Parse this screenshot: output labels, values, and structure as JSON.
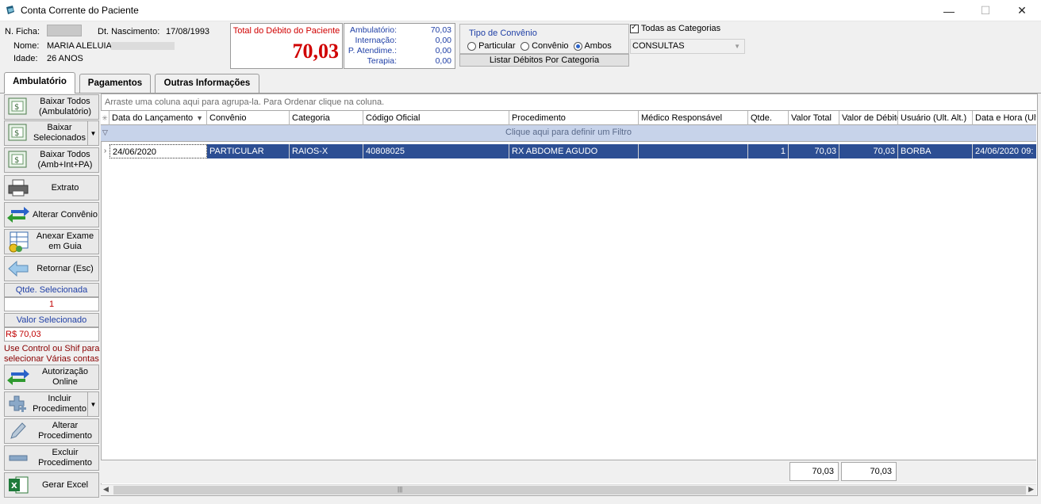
{
  "window": {
    "title": "Conta Corrente do Paciente",
    "minimize": "—",
    "maximize": "☐",
    "close": "✕"
  },
  "patient": {
    "ficha_label": "N. Ficha:",
    "nasc_label": "Dt. Nascimento:",
    "nasc_value": "17/08/1993",
    "nome_label": "Nome:",
    "nome_value": "MARIA ALELUIA",
    "idade_label": "Idade:",
    "idade_value": "26 ANOS"
  },
  "total": {
    "caption": "Total do Débito do Paciente",
    "value": "70,03"
  },
  "breakdown": [
    {
      "label": "Ambulatório:",
      "value": "70,03"
    },
    {
      "label": "Internação:",
      "value": "0,00"
    },
    {
      "label": "P. Atendime.:",
      "value": "0,00"
    },
    {
      "label": "Terapia:",
      "value": "0,00"
    }
  ],
  "tipo_convenio": {
    "caption": "Tipo de Convênio",
    "options": [
      "Particular",
      "Convênio",
      "Ambos"
    ],
    "selected": "Ambos",
    "listar_button": "Listar Débitos Por Categoria"
  },
  "categorias": {
    "todas_label": "Todas as Categorias",
    "select_value": "CONSULTAS"
  },
  "tabs": [
    "Ambulatório",
    "Pagamentos",
    "Outras Informações"
  ],
  "side_buttons": {
    "baixar_todos": "Baixar Todos (Ambulatório)",
    "baixar_sel": "Baixar Selecionados",
    "baixar_todos_amb": "Baixar Todos (Amb+Int+PA)",
    "extrato": "Extrato",
    "alterar_convenio": "Alterar Convênio",
    "anexar_exame": "Anexar Exame em Guia",
    "retornar": "Retornar (Esc)",
    "autorizacao": "Autorização Online",
    "incluir": "Incluir Procedimento",
    "alterar_proc": "Alterar Procedimento",
    "excluir_proc": "Excluir Procedimento",
    "gerar_excel": "Gerar Excel"
  },
  "selection": {
    "qtde_caption": "Qtde. Selecionada",
    "qtde_value": "1",
    "valor_caption": "Valor Selecionado",
    "valor_value": "R$ 70,03",
    "hint": "Use Control ou Shif para selecionar Várias contas"
  },
  "grid": {
    "group_hint": "Arraste uma coluna aqui para agrupa-la. Para Ordenar clique na coluna.",
    "filter_hint": "Clique aqui para definir um Filtro",
    "columns": [
      "Data do Lançamento",
      "Convênio",
      "Categoria",
      "Código Oficial",
      "Procedimento",
      "Médico Responsável",
      "Qtde.",
      "Valor Total",
      "Valor de Débito",
      "Usuário (Ult. Alt.)",
      "Data e Hora (Ult. Alt.)"
    ],
    "rows": [
      {
        "data": "24/06/2020",
        "convenio": "PARTICULAR",
        "categoria": "RAIOS-X",
        "codigo": "40808025",
        "procedimento": "RX ABDOME AGUDO",
        "medico": "",
        "qtde": "1",
        "valor_total": "70,03",
        "valor_debito": "70,03",
        "usuario": "BORBA",
        "data_hora": "24/06/2020 09:"
      }
    ],
    "totals": {
      "valor_total": "70,03",
      "valor_debito": "70,03"
    }
  },
  "colors": {
    "accent_red": "#d00000",
    "label_blue": "#1f3fa6",
    "selection": "#2c4e93"
  }
}
